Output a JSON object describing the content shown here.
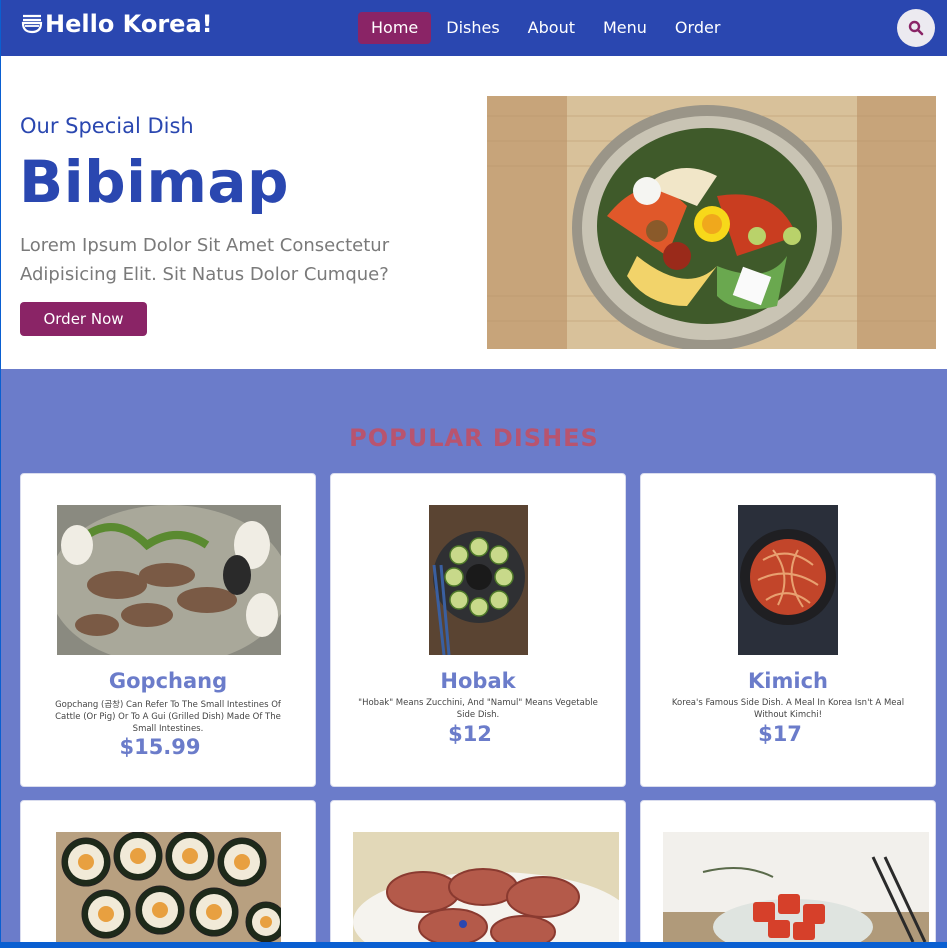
{
  "header": {
    "logo_text": "Hello Korea!",
    "nav": [
      "Home",
      "Dishes",
      "About",
      "Menu",
      "Order"
    ],
    "active_nav": "Home"
  },
  "hero": {
    "subtitle": "Our Special Dish",
    "title": "Bibimap",
    "text": "Lorem Ipsum Dolor Sit Amet Consectetur Adipisicing Elit. Sit Natus Dolor Cumque?",
    "button": "Order Now"
  },
  "popular": {
    "title": "POPULAR DISHES",
    "dishes": [
      {
        "name": "Gopchang",
        "desc": "Gopchang (곱창) Can Refer To The Small Intestines Of Cattle (Or Pig) Or To A Gui (Grilled Dish) Made Of The Small Intestines.",
        "price": "$15.99"
      },
      {
        "name": "Hobak",
        "desc": "\"Hobak\" Means Zucchini, And \"Namul\" Means Vegetable Side Dish.",
        "price": "$12"
      },
      {
        "name": "Kimich",
        "desc": "Korea's Famous Side Dish. A Meal In Korea Isn't A Meal Without Kimchi!",
        "price": "$17"
      }
    ]
  },
  "colors": {
    "primary": "#2a47b0",
    "accent": "#8a2466",
    "section_bg": "#6b7cca"
  }
}
